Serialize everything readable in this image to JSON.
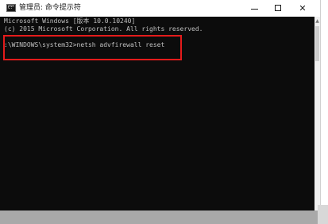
{
  "window": {
    "title": "管理员: 命令提示符",
    "minimize_icon": "minimize-icon",
    "maximize_icon": "maximize-icon",
    "close_glyph": "✕"
  },
  "console": {
    "lines": [
      "Microsoft Windows [版本 10.0.10240]",
      "(c) 2015 Microsoft Corporation. All rights reserved.",
      ":\\WINDOWS\\system32>netsh advfirewall reset"
    ],
    "text_color": "#c0c0c0",
    "background": "#0c0c0c",
    "highlight_color": "#e41b1b"
  },
  "scrollbar": {
    "up_arrow": "▲"
  }
}
